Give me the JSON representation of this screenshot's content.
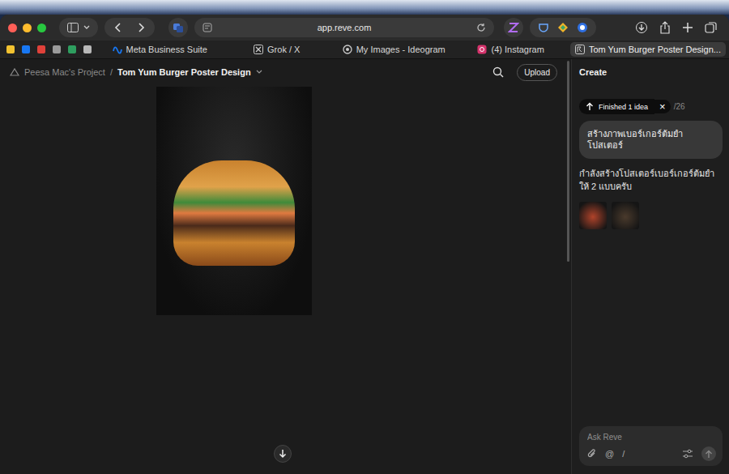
{
  "browser": {
    "url": "app.reve.com",
    "tabs": [
      {
        "label": "Meta Business Suite",
        "selected": false
      },
      {
        "label": "Grok / X",
        "selected": false
      },
      {
        "label": "My Images - Ideogram",
        "selected": false
      },
      {
        "label": "(4) Instagram",
        "selected": false
      },
      {
        "label": "Tom Yum Burger Poster Design...",
        "selected": true
      }
    ]
  },
  "project": {
    "name": "Peesa Mac's Project",
    "separator": "/",
    "title": "Tom Yum Burger Poster Design",
    "upload": "Upload"
  },
  "panel": {
    "title": "Create",
    "status": "Finished 1 idea",
    "close": "×",
    "counter": "/26",
    "messages": [
      {
        "kind": "user",
        "text": "สร้างภาพเบอร์เกอร์ต้มยำ โปสเตอร์"
      },
      {
        "kind": "assistant",
        "text": "กำลังสร้างโปสเตอร์เบอร์เกอร์ต้มยำให้ 2 แบบครับ"
      }
    ],
    "thumbnails": [
      {
        "color": "#b0432a"
      },
      {
        "color": "#4a3a2c"
      }
    ],
    "input": {
      "placeholder": "Ask Reve",
      "tools": [
        "@",
        "/"
      ]
    }
  }
}
